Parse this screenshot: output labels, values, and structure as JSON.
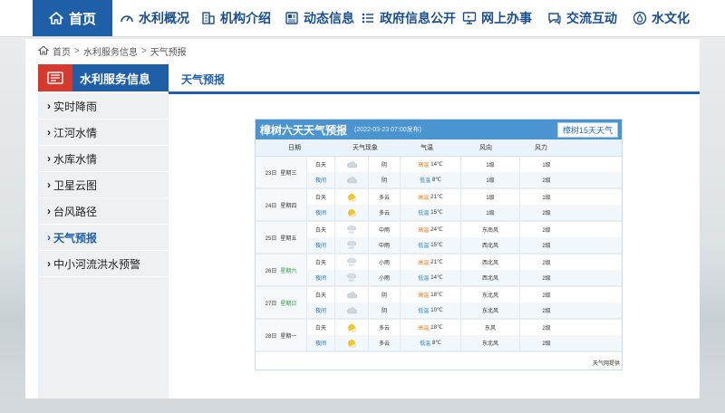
{
  "nav": {
    "home": "首页",
    "items": [
      {
        "label": "水利概况",
        "icon": "dashboard-icon"
      },
      {
        "label": "机构介绍",
        "icon": "building-icon"
      },
      {
        "label": "动态信息",
        "icon": "news-icon"
      },
      {
        "label": "政府信息公开",
        "icon": "list-icon"
      },
      {
        "label": "网上办事",
        "icon": "monitor-icon"
      },
      {
        "label": "交流互动",
        "icon": "chat-icon"
      },
      {
        "label": "水文化",
        "icon": "water-drop-icon"
      }
    ]
  },
  "breadcrumb": {
    "items": [
      "首页",
      "水利服务信息",
      "天气预报"
    ],
    "sep": ">"
  },
  "sidebar": {
    "title": "水利服务信息",
    "items": [
      {
        "label": "实时降雨",
        "active": false
      },
      {
        "label": "江河水情",
        "active": false
      },
      {
        "label": "水库水情",
        "active": false
      },
      {
        "label": "卫星云图",
        "active": false
      },
      {
        "label": "台风路径",
        "active": false
      },
      {
        "label": "天气预报",
        "active": true
      },
      {
        "label": "中小河流洪水预警",
        "active": false
      }
    ]
  },
  "main": {
    "title": "天气预报"
  },
  "weather": {
    "title": "樟树六天天气预报",
    "issued": "(2022-03-23 07:00发布)",
    "button": "樟树15天天气",
    "columns": [
      "日期",
      "天气现象",
      "气温",
      "风向",
      "风力"
    ],
    "day_label": "白天",
    "night_label": "夜间",
    "high_label": "高温",
    "low_label": "低温",
    "days": [
      {
        "date": "23日",
        "weekday": "星期三",
        "weekend": false,
        "day": {
          "icon": "cloudy-icon",
          "desc": "阴",
          "temp": "14℃",
          "wind": "1级",
          "power": "1级"
        },
        "night": {
          "icon": "cloudy-icon",
          "desc": "阴",
          "temp": "8℃",
          "wind": "1级",
          "power": "2级"
        }
      },
      {
        "date": "24日",
        "weekday": "星期四",
        "weekend": false,
        "day": {
          "icon": "sunny-cloud-icon",
          "desc": "多云",
          "temp": "21℃",
          "wind": "1级",
          "power": "1级"
        },
        "night": {
          "icon": "sunny-cloud-icon",
          "desc": "多云",
          "temp": "15℃",
          "wind": "1级",
          "power": "2级"
        }
      },
      {
        "date": "25日",
        "weekday": "星期五",
        "weekend": false,
        "day": {
          "icon": "rain-icon",
          "desc": "中雨",
          "temp": "24℃",
          "wind": "东南风",
          "power": "2级"
        },
        "night": {
          "icon": "rain-icon",
          "desc": "中雨",
          "temp": "15℃",
          "wind": "西北风",
          "power": "2级"
        }
      },
      {
        "date": "26日",
        "weekday": "星期六",
        "weekend": true,
        "day": {
          "icon": "rain-icon",
          "desc": "小雨",
          "temp": "21℃",
          "wind": "西北风",
          "power": "2级"
        },
        "night": {
          "icon": "rain-icon",
          "desc": "小雨",
          "temp": "14℃",
          "wind": "西北风",
          "power": "2级"
        }
      },
      {
        "date": "27日",
        "weekday": "星期日",
        "weekend": true,
        "day": {
          "icon": "cloudy-icon",
          "desc": "阴",
          "temp": "18℃",
          "wind": "东北风",
          "power": "2级"
        },
        "night": {
          "icon": "cloudy-icon",
          "desc": "阴",
          "temp": "10℃",
          "wind": "东北风",
          "power": "2级"
        }
      },
      {
        "date": "28日",
        "weekday": "星期一",
        "weekend": false,
        "day": {
          "icon": "sunny-cloud-icon",
          "desc": "多云",
          "temp": "18℃",
          "wind": "东风",
          "power": "2级"
        },
        "night": {
          "icon": "sunny-cloud-icon",
          "desc": "多云",
          "temp": "8℃",
          "wind": "东北风",
          "power": "2级"
        }
      }
    ],
    "footer": "天气网提供"
  },
  "colors": {
    "brand": "#1f5fa8",
    "accent": "#d63a2f",
    "weather_head": "#4a95cf",
    "high": "#e07b1a",
    "low": "#2b83c6",
    "weekend": "#2d9a3a"
  }
}
